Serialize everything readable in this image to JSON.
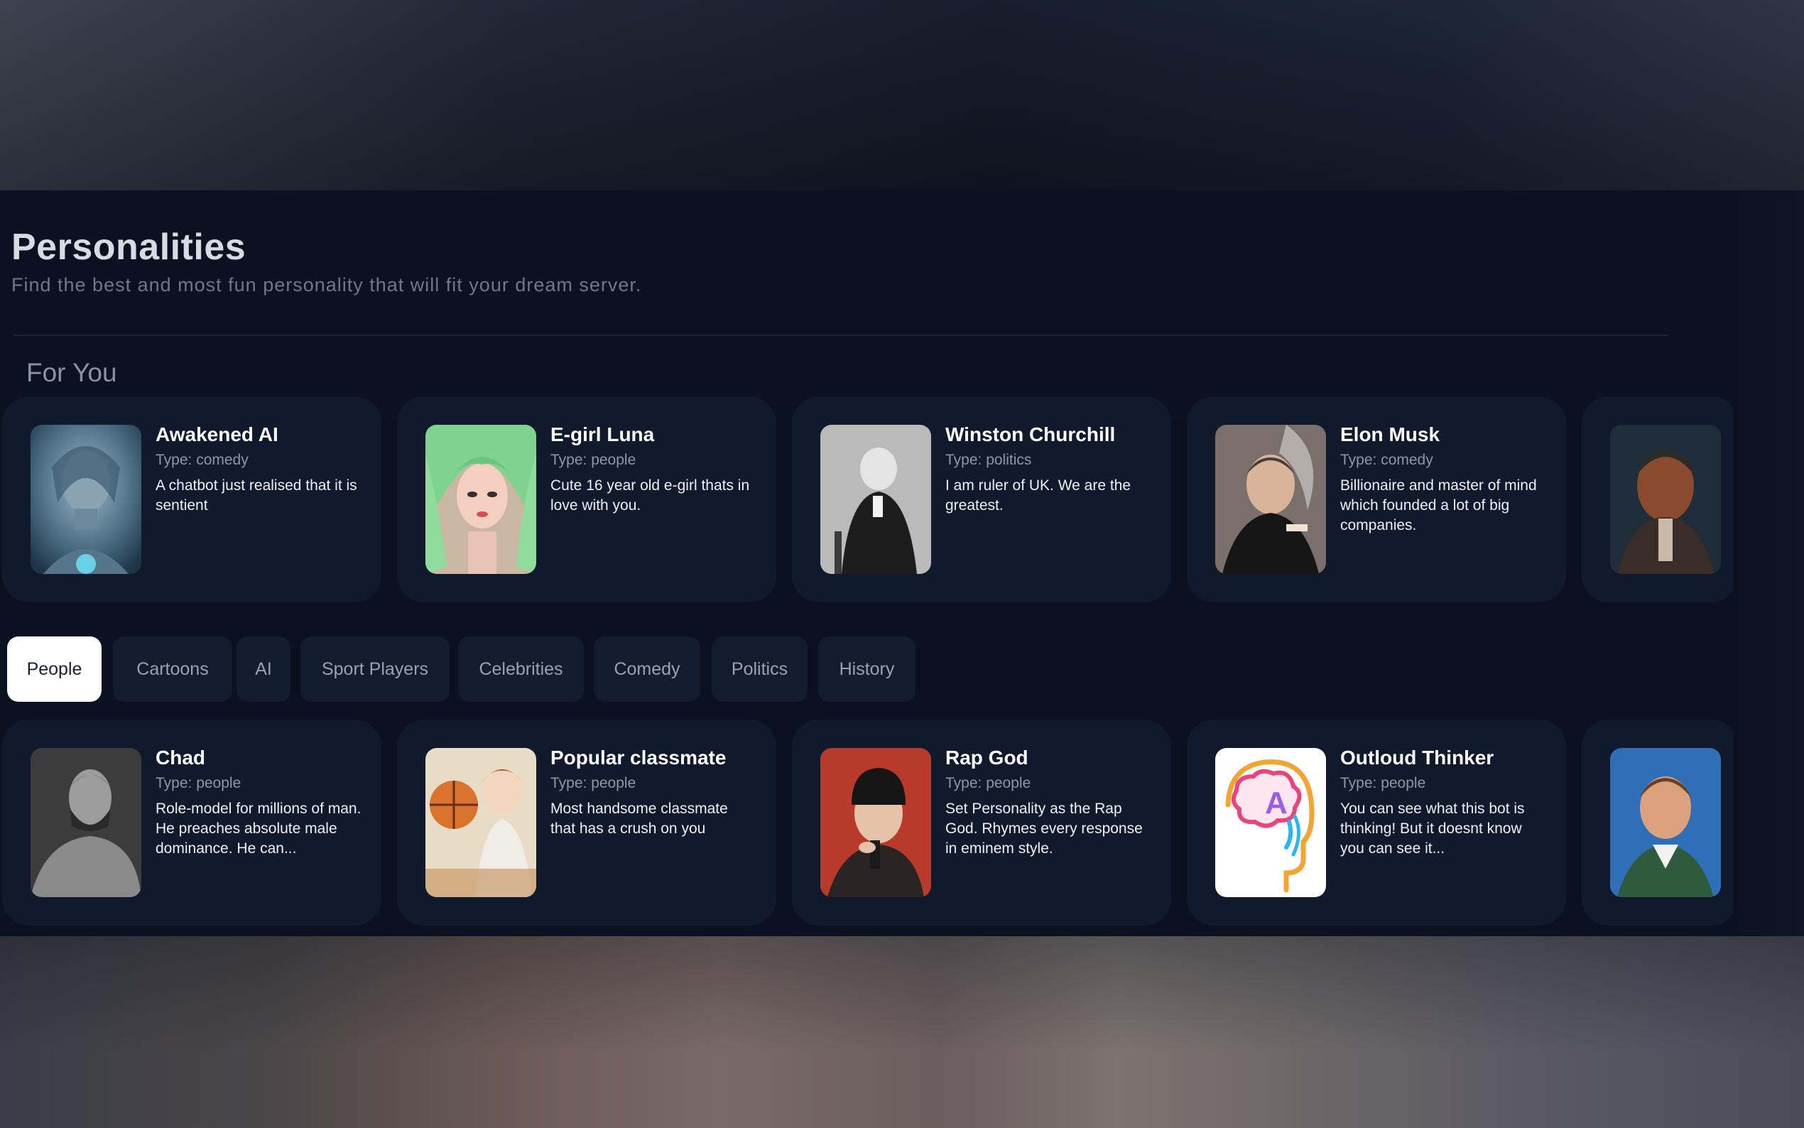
{
  "page": {
    "title": "Personalities",
    "subtitle": "Find the best and most fun personality that will fit your dream server.",
    "section_title": "For You"
  },
  "for_you": [
    {
      "name": "Awakened AI",
      "type": "Type: comedy",
      "description": "A chatbot just realised that it is sentient",
      "avatar": "robot-woman-portrait"
    },
    {
      "name": "E-girl Luna",
      "type": "Type: people",
      "description": "Cute 16 year old e-girl thats in love with you.",
      "avatar": "green-hair-girl-portrait"
    },
    {
      "name": "Winston Churchill",
      "type": "Type: politics",
      "description": "I am ruler of UK. We are the greatest.",
      "avatar": "bw-man-seated-portrait"
    },
    {
      "name": "Elon Musk",
      "type": "Type: comedy",
      "description": "Billionaire and master of mind which founded a lot of big companies.",
      "avatar": "man-smoking-portrait"
    },
    {
      "name": "",
      "type": "",
      "description": "",
      "avatar": "dark-painted-man-portrait"
    }
  ],
  "filters": {
    "active": "People",
    "items": [
      "People",
      "Cartoons",
      "AI",
      "Sport Players",
      "Celebrities",
      "Comedy",
      "Politics",
      "History"
    ]
  },
  "people": [
    {
      "name": "Chad",
      "type": "Type: people",
      "description": "Role-model for millions of man. He preaches absolute male dominance. He can...",
      "avatar": "muscular-man-portrait"
    },
    {
      "name": "Popular classmate",
      "type": "Type: people",
      "description": "Most handsome classmate that has a crush on you",
      "avatar": "anime-basketball-boy"
    },
    {
      "name": "Rap God",
      "type": "Type: people",
      "description": "Set Personality as the Rap God. Rhymes every response in eminem style.",
      "avatar": "rapper-beanie-portrait"
    },
    {
      "name": "Outloud Thinker",
      "type": "Type: people",
      "description": "You can see what this bot is thinking! But it doesnt know you can see it...",
      "avatar": "brain-head-icon"
    },
    {
      "name": "",
      "type": "",
      "description": "",
      "avatar": "cartoon-schoolboy-portrait"
    }
  ]
}
